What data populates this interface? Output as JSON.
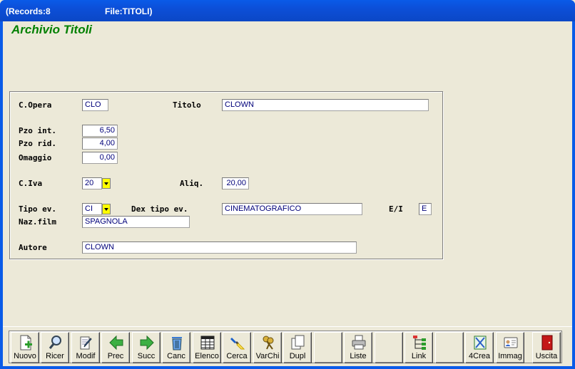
{
  "titlebar": {
    "records": "(Records:8",
    "file": "File:TITOLI)"
  },
  "app_title": "Archivio Titoli",
  "form": {
    "c_opera": {
      "label": "C.Opera",
      "value": "CLO"
    },
    "titolo": {
      "label": "Titolo",
      "value": "CLOWN"
    },
    "pzo_int": {
      "label": "Pzo int.",
      "value": "6,50"
    },
    "pzo_rid": {
      "label": "Pzo rid.",
      "value": "4,00"
    },
    "omaggio": {
      "label": "Omaggio",
      "value": "0,00"
    },
    "c_iva": {
      "label": "C.Iva",
      "value": "20"
    },
    "aliq": {
      "label": "Aliq.",
      "value": "20,00"
    },
    "tipo_ev": {
      "label": "Tipo ev.",
      "value": "CI"
    },
    "dex_tipo_ev": {
      "label": "Dex tipo ev.",
      "value": "CINEMATOGRAFICO"
    },
    "e_i": {
      "label": "E/I",
      "value": "E"
    },
    "naz_film": {
      "label": "Naz.film",
      "value": "SPAGNOLA"
    },
    "autore": {
      "label": "Autore",
      "value": "CLOWN"
    }
  },
  "toolbar": {
    "nuovo": "Nuovo",
    "ricer": "Ricer",
    "modif": "Modif",
    "prec": "Prec",
    "succ": "Succ",
    "canc": "Canc",
    "elenco": "Elenco",
    "cerca": "Cerca",
    "varchi": "VarChi",
    "dupl": "Dupl",
    "liste": "Liste",
    "link": "Link",
    "crea4": "4Crea",
    "immag": "Immag",
    "uscita": "Uscita"
  },
  "colors": {
    "title_green": "#008000",
    "field_text": "#00007a",
    "combo_yellow": "#ffff00",
    "titlebar_blue": "#0a5be8"
  }
}
